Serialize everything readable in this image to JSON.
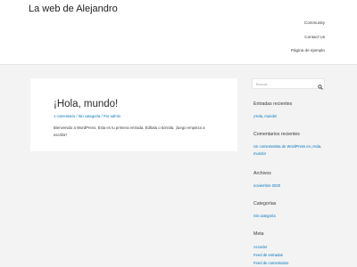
{
  "site": {
    "title": "La web de Alejandro"
  },
  "nav": {
    "items": [
      "Community",
      "Contact Us",
      "Página de ejemplo"
    ]
  },
  "post": {
    "title": "¡Hola, mundo!",
    "meta": "1 comentario / Sin categoría / Por admin",
    "excerpt": "Bienvenido a WordPress. Esta es tu primera entrada. Edítala o bórrala, ¡luego empieza a escribir!"
  },
  "sidebar": {
    "search_placeholder": "Buscar...",
    "widgets": [
      {
        "title": "Entradas recientes",
        "links": [
          "¡Hola, mundo!"
        ]
      },
      {
        "title": "Comentarios recientes",
        "links": [
          "Un comentarista de WordPress en ¡Hola,",
          "mundo!"
        ]
      },
      {
        "title": "Archivos",
        "links": [
          "noviembre 2020"
        ]
      },
      {
        "title": "Categorías",
        "links": [
          "Sin categoría"
        ]
      },
      {
        "title": "Meta",
        "links": [
          "Acceder",
          "Feed de entradas",
          "Feed de comentarios"
        ]
      }
    ]
  },
  "colors": {
    "link": "#0274be",
    "background": "#f3f3f3",
    "card": "#ffffff"
  }
}
